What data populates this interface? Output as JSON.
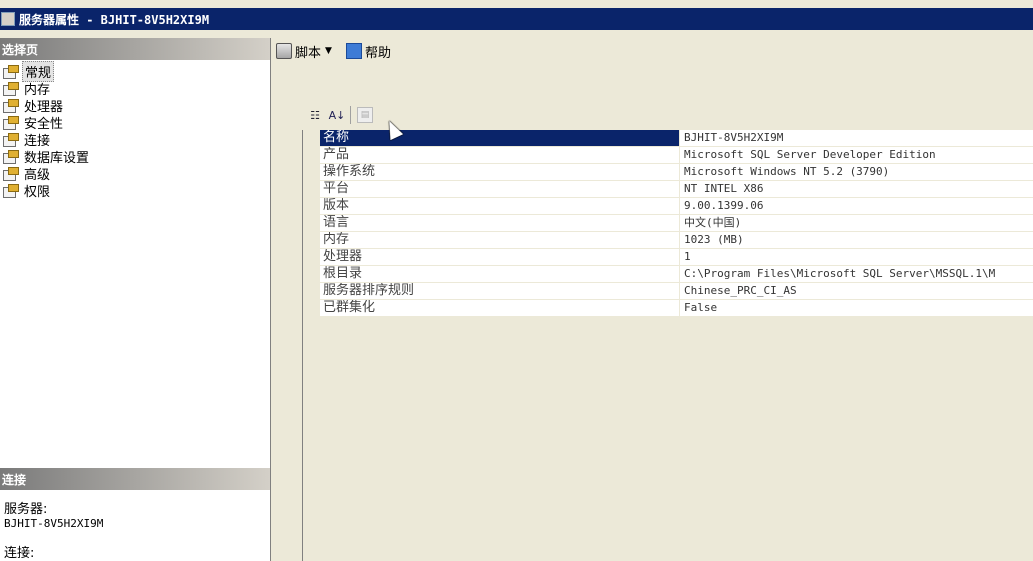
{
  "window": {
    "title": "服务器属性 - BJHIT-8V5H2XI9M"
  },
  "left_pane": {
    "header": "选择页",
    "pages": [
      {
        "label": "常规",
        "selected": true
      },
      {
        "label": "内存",
        "selected": false
      },
      {
        "label": "处理器",
        "selected": false
      },
      {
        "label": "安全性",
        "selected": false
      },
      {
        "label": "连接",
        "selected": false
      },
      {
        "label": "数据库设置",
        "selected": false
      },
      {
        "label": "高级",
        "selected": false
      },
      {
        "label": "权限",
        "selected": false
      }
    ],
    "connection": {
      "header": "连接",
      "server_label": "服务器:",
      "server_value": "BJHIT-8V5H2XI9M",
      "connection_label": "连接:"
    }
  },
  "toolbar": {
    "script_label": "脚本",
    "help_label": "帮助"
  },
  "grid_toolbar": {
    "sort_icon_text": "A\nZ"
  },
  "properties": [
    {
      "name": "名称",
      "value": "BJHIT-8V5H2XI9M"
    },
    {
      "name": "产品",
      "value": "Microsoft SQL Server Developer Edition"
    },
    {
      "name": "操作系统",
      "value": "Microsoft Windows NT 5.2 (3790)"
    },
    {
      "name": "平台",
      "value": "NT INTEL X86"
    },
    {
      "name": "版本",
      "value": "9.00.1399.06"
    },
    {
      "name": "语言",
      "value": "中文(中国)"
    },
    {
      "name": "内存",
      "value": "1023 (MB)"
    },
    {
      "name": "处理器",
      "value": "1"
    },
    {
      "name": "根目录",
      "value": "C:\\Program Files\\Microsoft SQL Server\\MSSQL.1\\M"
    },
    {
      "name": "服务器排序规则",
      "value": "Chinese_PRC_CI_AS"
    },
    {
      "name": "已群集化",
      "value": "False"
    }
  ],
  "colors": {
    "titlebar": "#0a246a",
    "selection": "#0a246a",
    "face": "#ece9d8"
  }
}
